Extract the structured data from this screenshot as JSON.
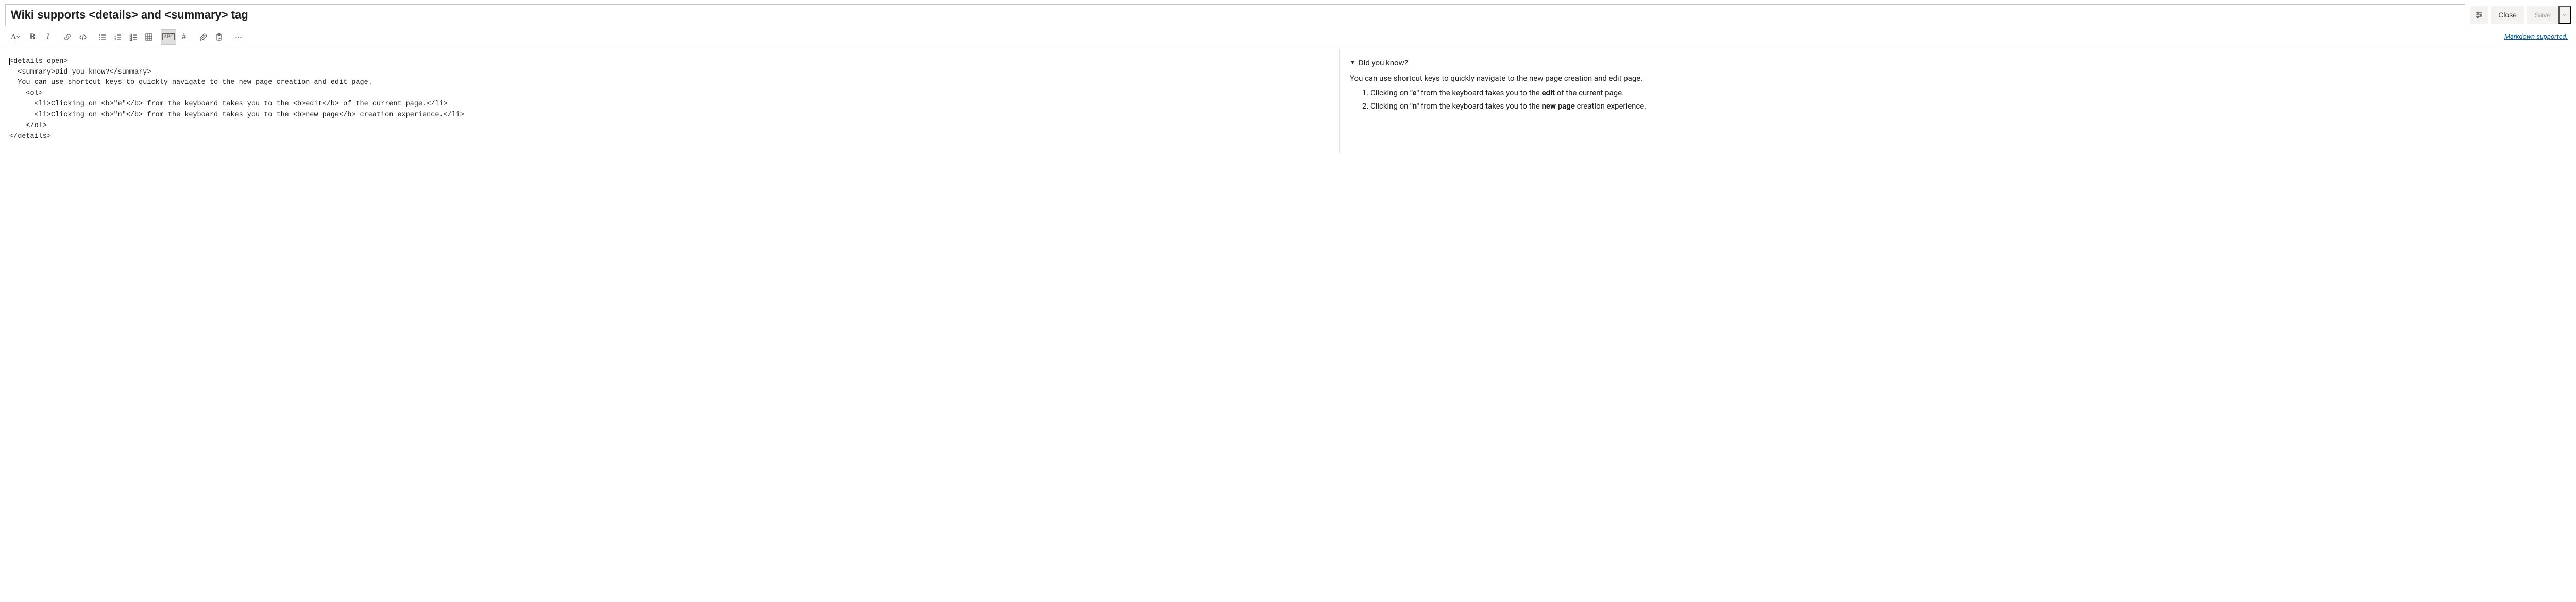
{
  "header": {
    "title": "Wiki supports <details> and <summary> tag",
    "close_label": "Close",
    "save_label": "Save"
  },
  "toolbar": {
    "markdown_supported": "Markdown supported."
  },
  "editor": {
    "raw_lines": [
      "<details open>",
      "  <summary>Did you know?</summary>",
      "  You can use shortcut keys to quickly navigate to the new page creation and edit page.",
      "    <ol>",
      "      <li>Clicking on <b>\"e\"</b> from the keyboard takes you to the <b>edit</b> of the current page.</li>",
      "      <li>Clicking on <b>\"n\"</b> from the keyboard takes you to the <b>new page</b> creation experience.</li>",
      "    </ol>",
      "</details>"
    ]
  },
  "preview": {
    "summary": "Did you know?",
    "intro": "You can use shortcut keys to quickly navigate to the new page creation and edit page.",
    "items": [
      {
        "pre": "Clicking on ",
        "b1": "\"e\"",
        "mid": " from the keyboard takes you to the ",
        "b2": "edit",
        "post": " of the current page."
      },
      {
        "pre": "Clicking on ",
        "b1": "\"n\"",
        "mid": " from the keyboard takes you to the ",
        "b2": "new page",
        "post": " creation experience."
      }
    ]
  }
}
